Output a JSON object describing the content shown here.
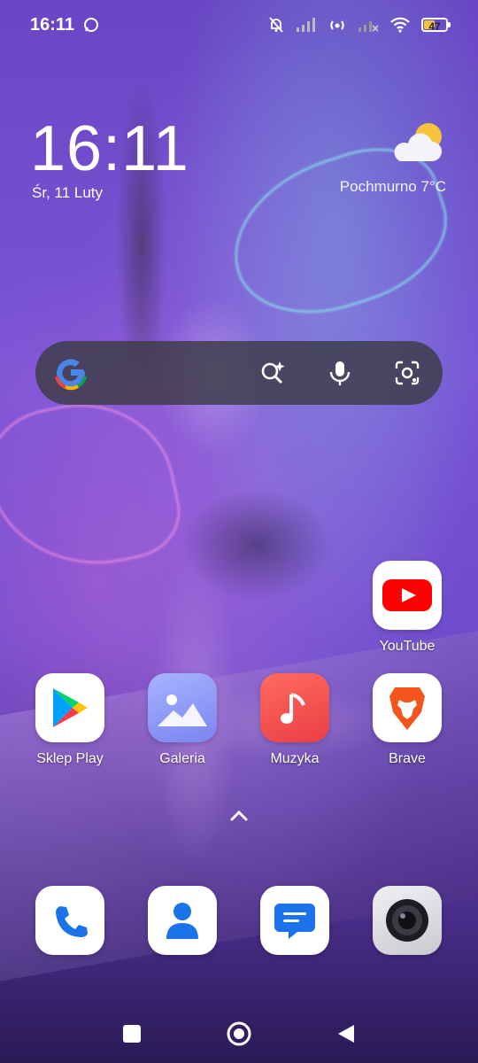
{
  "status_bar": {
    "time": "16:11",
    "icons": [
      "whatsapp-icon",
      "silent-icon",
      "signal-icon",
      "hotspot-icon",
      "signal-off-icon",
      "wifi-icon",
      "battery-icon"
    ],
    "battery_level": "47",
    "battery_color": "#f3c53a"
  },
  "clock_widget": {
    "time": "16:11",
    "date": "Śr, 11 Luty"
  },
  "weather_widget": {
    "condition": "Pochmurno",
    "temperature": "7°C",
    "icon": "cloudy-sun-icon"
  },
  "search_bar": {
    "logo": "google-logo",
    "actions": [
      "ai-search-icon",
      "microphone-icon",
      "lens-icon"
    ]
  },
  "apps": {
    "youtube": {
      "label": "YouTube",
      "color": "#ff0000"
    },
    "play_store": {
      "label": "Sklep Play"
    },
    "gallery": {
      "label": "Galeria",
      "color": "#7c83f0"
    },
    "music": {
      "label": "Muzyka",
      "color": "#f0504e"
    },
    "brave": {
      "label": "Brave",
      "color": "#f5541d"
    }
  },
  "dock": [
    "phone-icon",
    "contacts-icon",
    "messages-icon",
    "camera-icon"
  ],
  "nav_bar": [
    "recents-icon",
    "home-icon",
    "back-icon"
  ]
}
